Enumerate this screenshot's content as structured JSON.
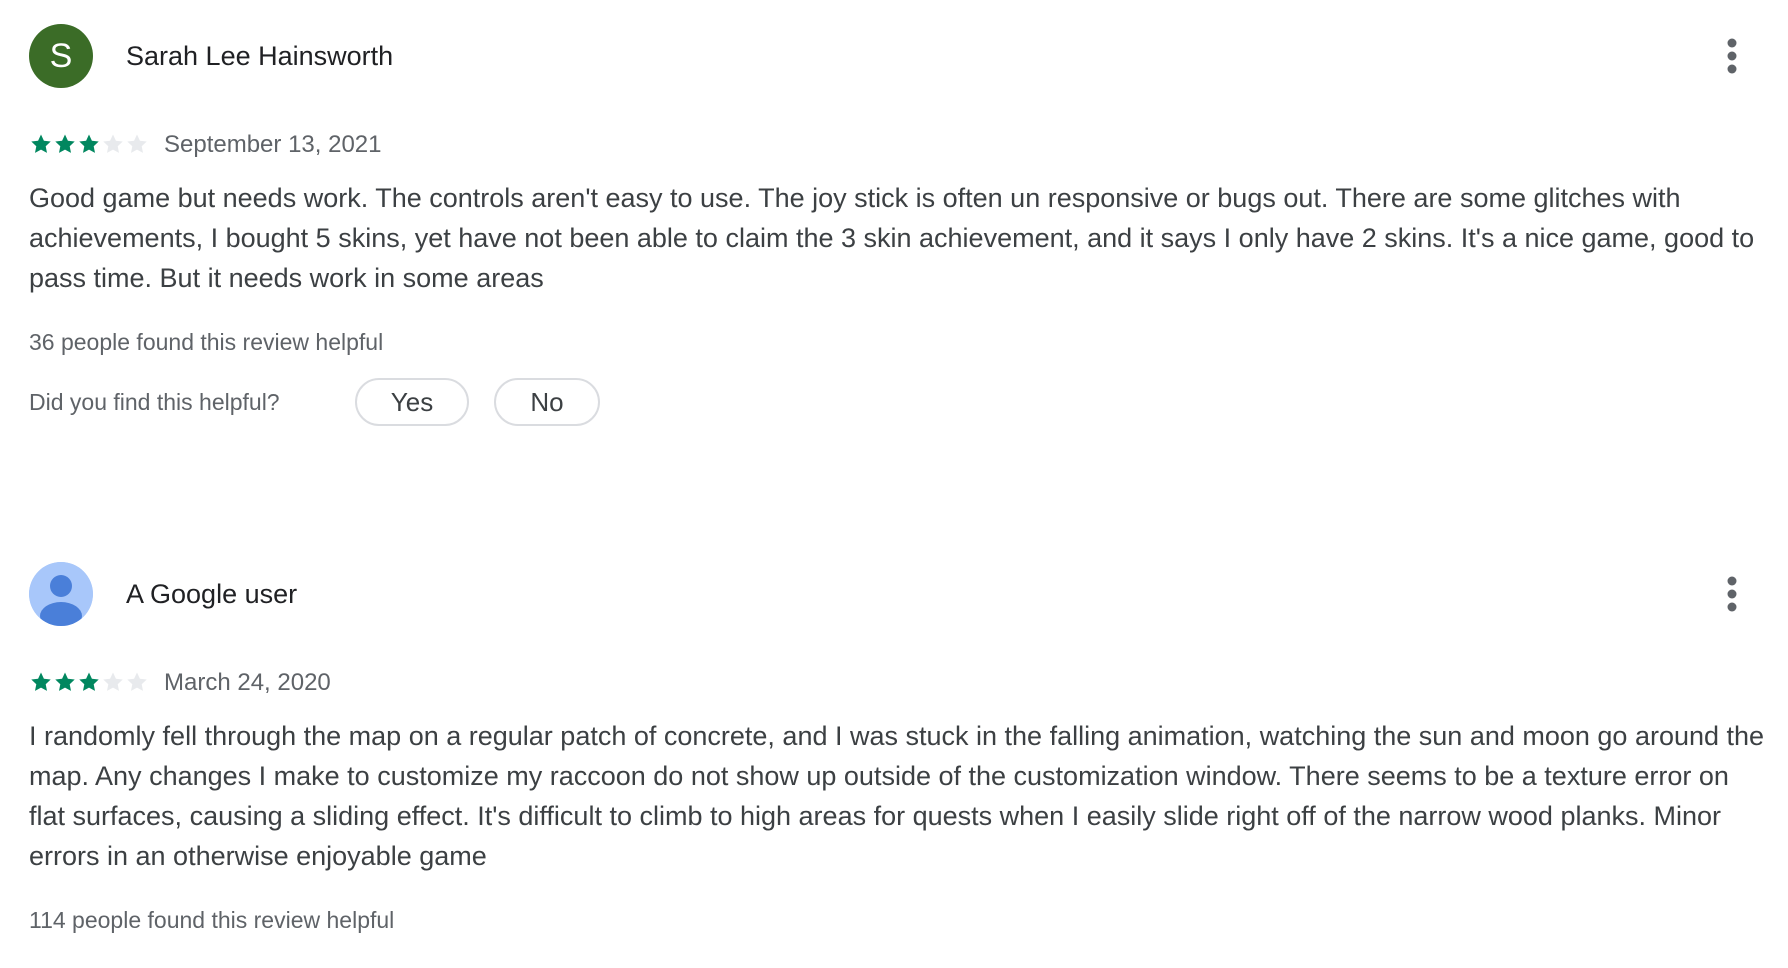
{
  "reviews": [
    {
      "author": "Sarah Lee Hainsworth",
      "avatar_letter": "S",
      "avatar_color": "#3b6c27",
      "rating": 3,
      "max_rating": 5,
      "date": "September 13, 2021",
      "text": "Good game but needs work. The controls aren't easy to use. The joy stick is often un responsive or bugs out. There are some glitches with achievements, I bought 5 skins, yet have not been able to claim the 3 skin achievement, and it says I only have 2 skins. It's a nice game, good to pass time. But it needs work in some areas",
      "helpful_count": "36 people found this review helpful",
      "helpful_question": "Did you find this helpful?",
      "yes_label": "Yes",
      "no_label": "No"
    },
    {
      "author": "A Google user",
      "avatar_icon": "default-user-icon",
      "rating": 3,
      "max_rating": 5,
      "date": "March 24, 2020",
      "text": "I randomly fell through the map on a regular patch of concrete, and I was stuck in the falling animation, watching the sun and moon go around the map. Any changes I make to customize my raccoon do not show up outside of the customization window. There seems to be a texture error on flat surfaces, causing a sliding effect. It's difficult to climb to high areas for quests when I easily slide right off of the narrow wood planks. Minor errors in an otherwise enjoyable game",
      "helpful_count": "114 people found this review helpful"
    }
  ],
  "colors": {
    "star_filled": "#01875f",
    "star_empty": "#e8eaed",
    "default_avatar_bg": "#a8c7fa",
    "default_avatar_fg": "#4a7fd9"
  },
  "icons": {
    "more": "more-vert-icon",
    "star": "star-icon"
  }
}
